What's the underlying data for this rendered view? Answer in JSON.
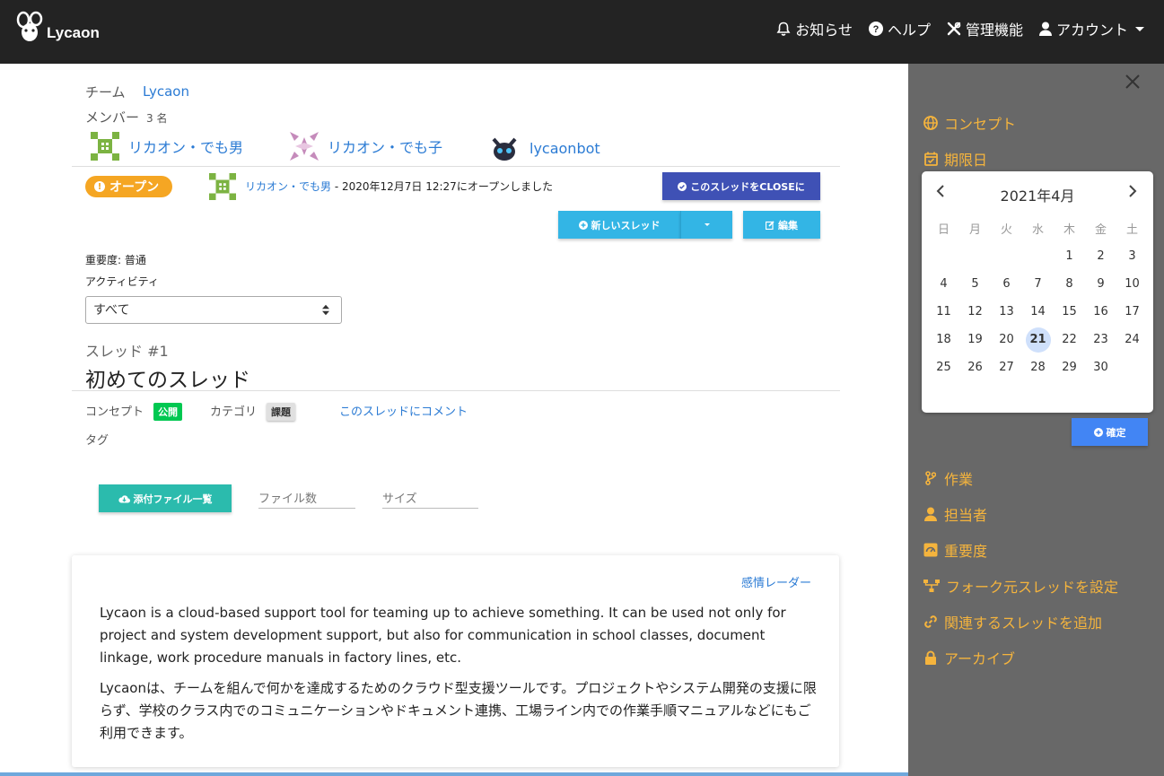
{
  "nav": {
    "logo_text": "Lycaon",
    "notifications": "お知らせ",
    "help": "ヘルプ",
    "admin": "管理機能",
    "account": "アカウント"
  },
  "team": {
    "label": "チーム",
    "name": "Lycaon",
    "members_label": "メンバー",
    "members_count": "3 名",
    "members": [
      {
        "name": "リカオン・でも男"
      },
      {
        "name": "リカオン・でも子"
      },
      {
        "name": "lycaonbot"
      }
    ]
  },
  "thread": {
    "status": "オープン",
    "opener": "リカオン・でも男",
    "opened_text": " - 2020年12月7日 12:27にオープンしました",
    "close_button": "このスレッドをCLOSEに",
    "new_thread_button": "新しいスレッド",
    "edit_button": "編集",
    "importance": "重要度: 普通",
    "activity_label": "アクティビティ",
    "activity_value": "すべて",
    "number": "スレッド #1",
    "title": "初めてのスレッド",
    "concept_label": "コンセプト",
    "concept_value": "公開",
    "category_label": "カテゴリ",
    "category_value": "課題",
    "comment_link": "このスレッドにコメント",
    "tag_label": "タグ",
    "attachments_button": "添付ファイル一覧",
    "file_count_label": "ファイル数",
    "size_label": "サイズ",
    "emotion_radar": "感情レーダー",
    "body_en": "Lycaon is a cloud-based support tool for teaming up to achieve something. It can be used not only for project and system development support, but also for communication in school classes, document linkage, work procedure manuals in factory lines, etc.",
    "body_ja": "Lycaonは、チームを組んで何かを達成するためのクラウド型支援ツールです。プロジェクトやシステム開発の支援に限らず、学校のクラス内でのコミュニケーションやドキュメント連携、工場ライン内での作業手順マニュアルなどにもご利用できます。"
  },
  "panel": {
    "concept": "コンセプト",
    "due_date": "期限日",
    "calendar": {
      "title": "2021年4月",
      "weekdays": [
        "日",
        "月",
        "火",
        "水",
        "木",
        "金",
        "土"
      ],
      "selected_day": 21
    },
    "confirm_button": "確定",
    "work": "作業",
    "assignee": "担当者",
    "importance": "重要度",
    "fork": "フォーク元スレッドを設定",
    "related": "関連するスレッドを追加",
    "archive": "アーカイブ"
  },
  "colors": {
    "navbar": "#232323",
    "panel": "#686868",
    "panel_accent": "#f5b43d",
    "link": "#2b7bd4",
    "open_badge": "#f5a623",
    "close_button": "#3f51b5",
    "action_button": "#33b5e5",
    "attachments_button": "#2bbbad",
    "confirm_button": "#4285f4",
    "concept_chip": "#00c851"
  }
}
